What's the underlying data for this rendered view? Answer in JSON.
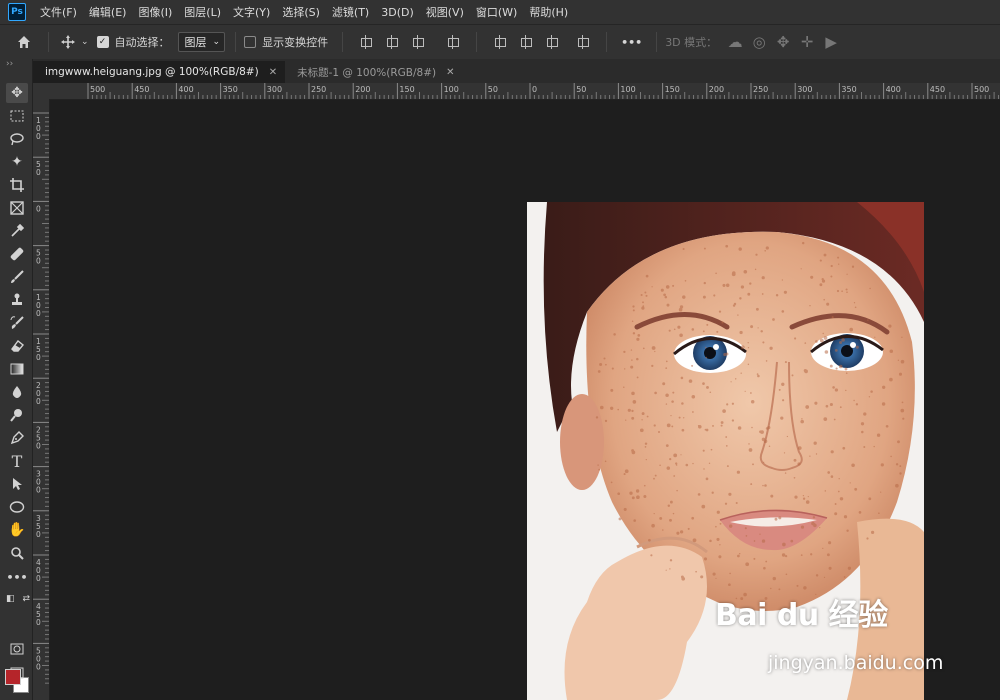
{
  "app": {
    "logo_text": "Ps"
  },
  "menu": [
    "文件(F)",
    "编辑(E)",
    "图像(I)",
    "图层(L)",
    "文字(Y)",
    "选择(S)",
    "滤镜(T)",
    "3D(D)",
    "视图(V)",
    "窗口(W)",
    "帮助(H)"
  ],
  "options": {
    "auto_select_label": "自动选择：",
    "auto_select_checked": true,
    "auto_select_target": "图层",
    "show_transform_label": "显示变换控件",
    "show_transform_checked": false,
    "more_label": "•••",
    "mode3d_label": "3D 模式："
  },
  "tabs": [
    {
      "label": "imgwww.heiguang.jpg @ 100%(RGB/8#)",
      "active": true
    },
    {
      "label": "未标题-1 @ 100%(RGB/8#)",
      "active": false
    }
  ],
  "hruler_labels": [
    "500",
    "450",
    "400",
    "350",
    "300",
    "250",
    "200",
    "150",
    "100",
    "50",
    "0",
    "50",
    "100",
    "150",
    "200",
    "250",
    "300",
    "350",
    "400",
    "450",
    "500"
  ],
  "vruler_labels": [
    "1 0 0",
    "5 0",
    "0",
    "5 0",
    "1 0 0",
    "1 5 0",
    "2 0 0",
    "2 5 0",
    "3 0 0",
    "3 5 0",
    "4 0 0",
    "4 5 0",
    "5 0 0"
  ],
  "swatches": {
    "foreground": "#b5252a",
    "background": "#ffffff"
  },
  "watermark": {
    "logo": "Bai du 经验",
    "url": "jingyan.baidu.com"
  }
}
